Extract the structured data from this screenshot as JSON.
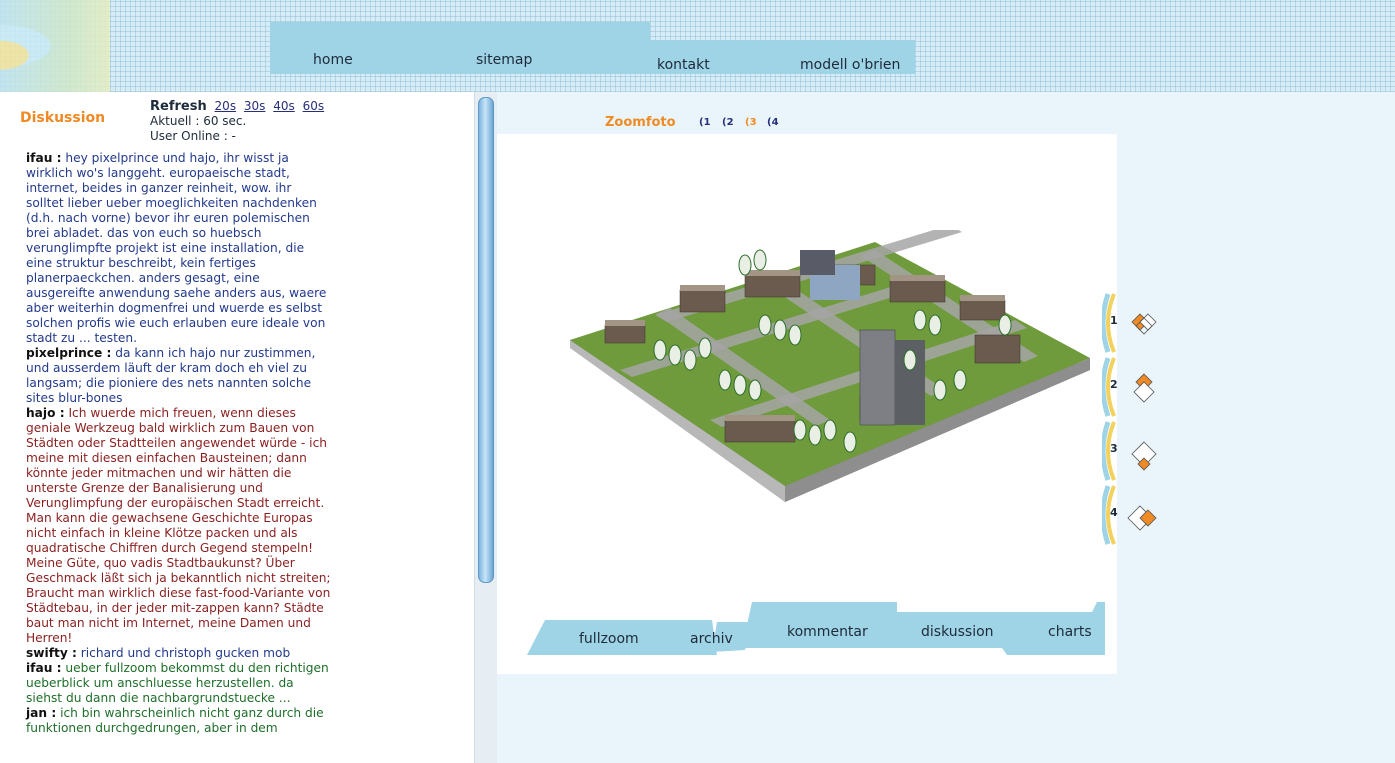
{
  "nav": {
    "home": "home",
    "sitemap": "sitemap",
    "kontakt": "kontakt",
    "modell": "modell o'brien"
  },
  "discussion": {
    "title": "Diskussion",
    "refresh_label": "Refresh",
    "refresh_options": [
      "20s",
      "30s",
      "40s",
      "60s"
    ],
    "current": "Aktuell : 60 sec.",
    "online": "User Online : -",
    "messages": [
      {
        "author": "ifau :",
        "text": "hey pixelprince und hajo, ihr wisst ja wirklich wo's langgeht. europaeische stadt, internet, beides in ganzer reinheit, wow. ihr solltet lieber ueber moeglichkeiten nachdenken (d.h. nach vorne) bevor ihr euren polemischen brei abladet. das von euch so huebsch verunglimpfte projekt ist eine installation, die eine struktur beschreibt, kein fertiges planerpaeckchen. anders gesagt, eine ausgereifte anwendung saehe anders aus, waere aber weiterhin dogmenfrei und wuerde es selbst solchen profis wie euch erlauben eure ideale von stadt zu ... testen.",
        "color": "#233a8c"
      },
      {
        "author": "pixelprince :",
        "text": "da kann ich hajo nur zustimmen, und ausserdem läuft der kram doch eh viel zu langsam; die pioniere des nets nannten solche sites blur-bones",
        "color": "#233a8c"
      },
      {
        "author": "hajo :",
        "text": "Ich wuerde mich freuen, wenn dieses geniale Werkzeug bald wirklich zum Bauen von Städten oder Stadtteilen angewendet würde - ich meine mit diesen einfachen Bausteinen; dann könnte jeder mitmachen und wir hätten die unterste Grenze der Banalisierung und Verunglimpfung der europäischen Stadt erreicht. Man kann die gewachsene Geschichte Europas nicht einfach in kleine Klötze packen und als quadratische Chiffren durch Gegend stempeln! Meine Güte, quo vadis Stadtbaukunst? Über Geschmack läßt sich ja bekanntlich nicht streiten; Braucht man wirklich diese fast-food-Variante von Städtebau, in der jeder mit-zappen kann? Städte baut man nicht im Internet, meine Damen und Herren!",
        "color": "#8a1f1f"
      },
      {
        "author": "swifty :",
        "text": "richard und christoph gucken mob",
        "color": "#233a8c"
      },
      {
        "author": "ifau :",
        "text": "ueber fullzoom bekommst du den richtigen ueberblick um anschluesse herzustellen. da siehst du dann die nachbargrundstuecke ...",
        "color": "#1f6e2a"
      },
      {
        "author": "jan :",
        "text": "ich bin wahrscheinlich nicht ganz durch die funktionen durchgedrungen, aber in dem",
        "color": "#1f6e2a"
      }
    ]
  },
  "zoom": {
    "title": "Zoomfoto",
    "links": [
      "(1",
      "(2",
      "(3",
      "(4"
    ],
    "active_link": 2
  },
  "tabs": {
    "fullzoom": "fullzoom",
    "archiv": "archiv",
    "kommentar": "kommentar",
    "diskussion": "diskussion",
    "charts": "charts"
  },
  "side_buttons": [
    "1",
    "2",
    "3",
    "4"
  ],
  "colors": {
    "accent": "#ef8a24",
    "nav_band": "#9fd3e6",
    "link": "#27317a"
  }
}
